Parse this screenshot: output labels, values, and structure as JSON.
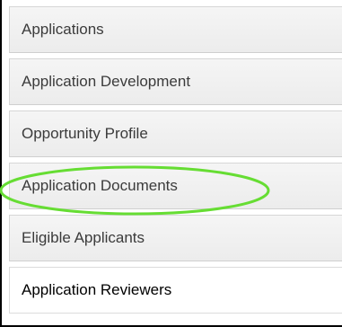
{
  "nav": {
    "items": [
      {
        "label": "Applications"
      },
      {
        "label": "Application Development"
      },
      {
        "label": "Opportunity Profile"
      },
      {
        "label": "Application Documents"
      },
      {
        "label": "Eligible Applicants"
      },
      {
        "label": "Application Reviewers"
      }
    ],
    "active_index": 5
  },
  "highlight": {
    "target": "Application Documents",
    "color": "#66dd33"
  }
}
